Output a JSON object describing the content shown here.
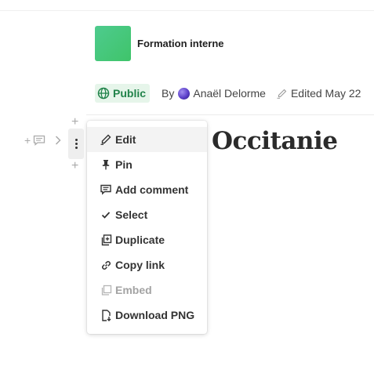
{
  "space": {
    "title": "Formation interne",
    "icon_color": "#45c77a"
  },
  "meta": {
    "visibility": "Public",
    "by_label": "By",
    "author": "Anaël Delorme",
    "edited": "Edited May 22"
  },
  "page": {
    "heading": "Occitanie"
  },
  "gutter": {
    "add_label": "+",
    "plus_label": "+"
  },
  "menu": {
    "items": [
      {
        "label": "Edit",
        "icon": "pen-icon",
        "state": "hover"
      },
      {
        "label": "Pin",
        "icon": "pin-icon",
        "state": "normal"
      },
      {
        "label": "Add comment",
        "icon": "comment-icon",
        "state": "normal"
      },
      {
        "label": "Select",
        "icon": "check-icon",
        "state": "normal"
      },
      {
        "label": "Duplicate",
        "icon": "duplicate-icon",
        "state": "normal"
      },
      {
        "label": "Copy link",
        "icon": "link-icon",
        "state": "normal"
      },
      {
        "label": "Embed",
        "icon": "embed-icon",
        "state": "disabled"
      },
      {
        "label": "Download PNG",
        "icon": "download-icon",
        "state": "normal"
      }
    ]
  },
  "colors": {
    "badge_bg": "#e6f5ea",
    "badge_text": "#21834a",
    "text": "#333333",
    "disabled": "#a3a3a3"
  }
}
